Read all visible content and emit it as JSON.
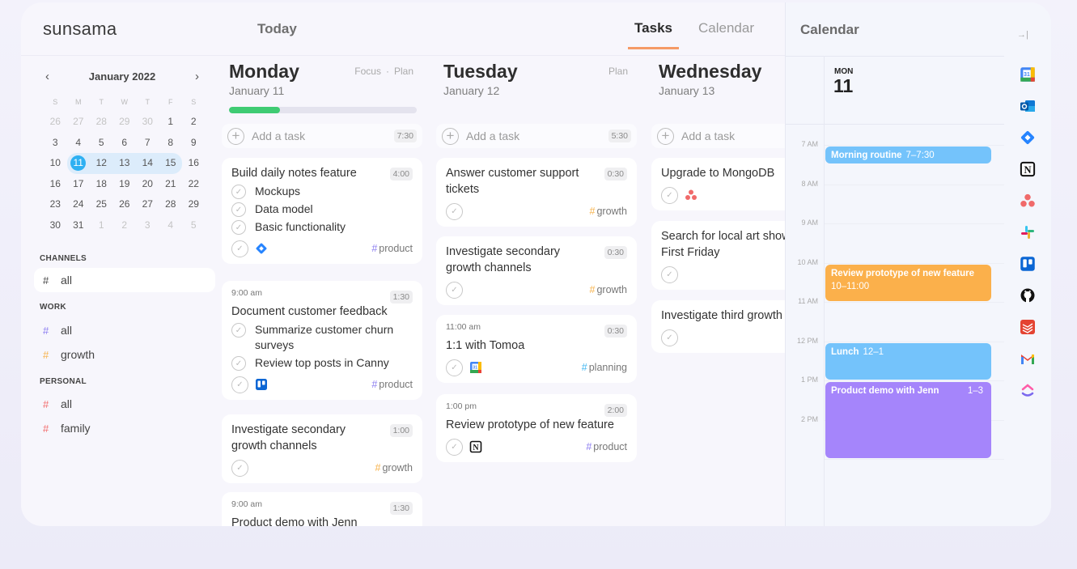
{
  "app": {
    "logo": "sunsama"
  },
  "topbar": {
    "today_label": "Today",
    "tabs": [
      {
        "label": "Tasks",
        "active": true
      },
      {
        "label": "Calendar",
        "active": false
      }
    ],
    "accent": "#f59a66"
  },
  "mini_calendar": {
    "month_label": "January 2022",
    "prev_icon": "chevron-left-icon",
    "next_icon": "chevron-right-icon",
    "weekdays": [
      "S",
      "M",
      "T",
      "W",
      "T",
      "F",
      "S"
    ],
    "weeks": [
      [
        "26",
        "27",
        "28",
        "29",
        "30",
        "1",
        "2"
      ],
      [
        "3",
        "4",
        "5",
        "6",
        "7",
        "8",
        "9"
      ],
      [
        "10",
        "11",
        "12",
        "13",
        "14",
        "15",
        "16"
      ],
      [
        "16",
        "17",
        "18",
        "19",
        "20",
        "21",
        "22"
      ],
      [
        "23",
        "24",
        "25",
        "26",
        "27",
        "28",
        "29"
      ],
      [
        "30",
        "31",
        "1",
        "2",
        "3",
        "4",
        "5"
      ]
    ],
    "selected": "11",
    "highlight_color": "#2eb0f2"
  },
  "sidebar": {
    "channels_label": "CHANNELS",
    "channels_all": {
      "hash": "#",
      "label": "all",
      "color": "#333333"
    },
    "work_label": "WORK",
    "work": [
      {
        "hash": "#",
        "label": "all",
        "color": "#8b7cf0"
      },
      {
        "hash": "#",
        "label": "growth",
        "color": "#f7b24a"
      }
    ],
    "personal_label": "PERSONAL",
    "personal": [
      {
        "hash": "#",
        "label": "all",
        "color": "#f26b6b"
      },
      {
        "hash": "#",
        "label": "family",
        "color": "#f26b6b"
      }
    ]
  },
  "days": [
    {
      "name": "Monday",
      "date": "January 11",
      "actions": [
        "Focus",
        "·",
        "Plan"
      ],
      "progress_percent": 27,
      "add_task": {
        "placeholder": "Add a task",
        "total": "7:30"
      },
      "cards": [
        {
          "time": "",
          "title": "Build daily notes feature",
          "duration": "4:00",
          "subtasks": [
            "Mockups",
            "Data model",
            "Basic functionality"
          ],
          "integration": "jira-icon",
          "tag": "product",
          "tag_color": "#8b7cf0"
        },
        {
          "time": "9:00 am",
          "title": "Document customer feedback",
          "duration": "1:30",
          "subtasks": [
            "Summarize customer churn surveys",
            "Review top posts in Canny"
          ],
          "integration": "trello-icon",
          "tag": "product",
          "tag_color": "#8b7cf0"
        },
        {
          "time": "",
          "title": "Investigate secondary growth channels",
          "duration": "1:00",
          "subtasks": [],
          "integration": "",
          "tag": "growth",
          "tag_color": "#f7b24a"
        },
        {
          "time": "9:00 am",
          "title": "Product demo with Jenn",
          "duration": "1:30",
          "subtasks": [],
          "integration": "",
          "tag": "",
          "tag_color": ""
        }
      ]
    },
    {
      "name": "Tuesday",
      "date": "January 12",
      "actions": [
        "Plan"
      ],
      "add_task": {
        "placeholder": "Add a task",
        "total": "5:30"
      },
      "cards": [
        {
          "time": "",
          "title": "Answer customer support tickets",
          "duration": "0:30",
          "subtasks": [],
          "integration": "",
          "tag": "growth",
          "tag_color": "#f7b24a"
        },
        {
          "time": "",
          "title": "Investigate secondary growth channels",
          "duration": "0:30",
          "subtasks": [],
          "integration": "",
          "tag": "growth",
          "tag_color": "#f7b24a"
        },
        {
          "time": "11:00 am",
          "title": "1:1 with Tomoa",
          "duration": "0:30",
          "subtasks": [],
          "integration": "google-calendar-icon",
          "tag": "planning",
          "tag_color": "#3fb6f0"
        },
        {
          "time": "1:00 pm",
          "title": "Review prototype of new feature",
          "duration": "2:00",
          "subtasks": [],
          "integration": "notion-icon",
          "tag": "product",
          "tag_color": "#8b7cf0"
        }
      ]
    },
    {
      "name": "Wednesday",
      "date": "January 13",
      "actions": [],
      "add_task": {
        "placeholder": "Add a task",
        "total": ""
      },
      "cards": [
        {
          "time": "",
          "title": "Upgrade to MongoDB",
          "duration": "",
          "subtasks": [],
          "integration": "asana-icon",
          "tag": "",
          "tag_color": ""
        },
        {
          "time": "",
          "title": "Search for local art shows on First Friday",
          "duration": "",
          "subtasks": [],
          "integration": "",
          "tag": "",
          "tag_color": ""
        },
        {
          "time": "",
          "title": "Investigate third growth channels",
          "duration": "",
          "subtasks": [],
          "integration": "",
          "tag": "",
          "tag_color": ""
        }
      ]
    }
  ],
  "calendar_pane": {
    "title": "Calendar",
    "collapse_icon": "collapse-right-icon",
    "day_of_week": "MON",
    "day_number": "11",
    "hours": [
      "7 AM",
      "8 AM",
      "9 AM",
      "10 AM",
      "11 AM",
      "12 PM",
      "1 PM",
      "2 PM"
    ],
    "events": [
      {
        "title": "Morning routine",
        "time": "7–7:30",
        "start": 7.0,
        "end": 7.5,
        "color": "#74c3fb",
        "time_layout": "inline"
      },
      {
        "title": "Review prototype of new feature",
        "time": "10–11:00",
        "start": 10.0,
        "end": 11.0,
        "color": "#fbb04b",
        "time_layout": "below"
      },
      {
        "title": "Lunch",
        "time": "12–1",
        "start": 12.0,
        "end": 13.0,
        "color": "#74c3fb",
        "time_layout": "inline"
      },
      {
        "title": "Product demo with Jenn",
        "time": "1–3",
        "start": 13.0,
        "end": 15.0,
        "color": "#a585fb",
        "time_layout": "right"
      }
    ]
  },
  "integrations": [
    "google-calendar-icon",
    "outlook-icon",
    "jira-icon",
    "notion-icon",
    "asana-icon",
    "slack-icon",
    "trello-icon",
    "github-icon",
    "todoist-icon",
    "gmail-icon",
    "clickup-icon"
  ]
}
